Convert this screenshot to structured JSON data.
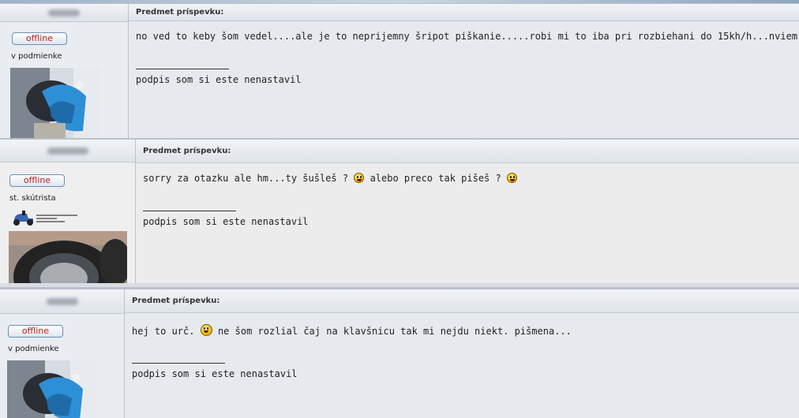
{
  "subject_header": "Predmet príspevku:",
  "offline_label": "offline",
  "signature": "podpis som si este nenastavil",
  "posts": [
    {
      "rank": "v podmienke",
      "message": "no ved to keby šom vedel....ale je to neprijemny šripot piškanie.....robi mi to iba pri rozbiehani do 15kh/h...nviem može to byť v špojke?"
    },
    {
      "rank": "st. skútrista",
      "message_part1": "sorry za otazku ale hm...ty šušleš ?",
      "message_part2": "alebo preco tak pišeš ?"
    },
    {
      "rank": "v podmienke",
      "message_part1": "hej to urč.",
      "message_part2": "ne šom rozlial čaj na klavšnicu tak mi nejdu niekt. pišmena..."
    }
  ],
  "icons": [
    "offline-badge-icon",
    "smiley-icon",
    "laughing-smiley-icon",
    "scooter-rank-icon",
    "avatar-image"
  ],
  "colors": {
    "offline_text": "#c01c1c",
    "post_bg": "#e6e9ee",
    "border": "#b9c1cc"
  }
}
